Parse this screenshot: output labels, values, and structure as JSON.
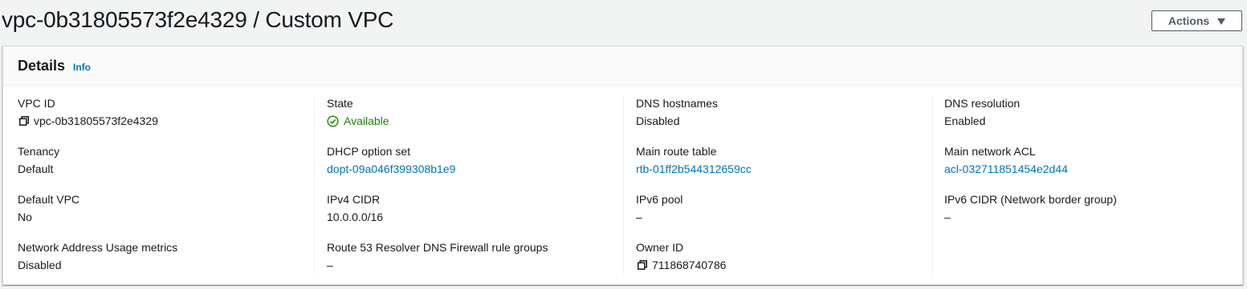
{
  "header": {
    "title": "vpc-0b31805573f2e4329 / Custom VPC",
    "actions_label": "Actions"
  },
  "details": {
    "title": "Details",
    "info_label": "Info",
    "columns": [
      {
        "fields": [
          {
            "label": "VPC ID",
            "value": "vpc-0b31805573f2e4329",
            "icon": "copy-icon"
          },
          {
            "label": "Tenancy",
            "value": "Default"
          },
          {
            "label": "Default VPC",
            "value": "No"
          },
          {
            "label": "Network Address Usage metrics",
            "value": "Disabled"
          }
        ]
      },
      {
        "fields": [
          {
            "label": "State",
            "value": "Available",
            "icon": "check-circle-icon",
            "status_color": "#1d8102"
          },
          {
            "label": "DHCP option set",
            "value": "dopt-09a046f399308b1e9",
            "link": true
          },
          {
            "label": "IPv4 CIDR",
            "value": "10.0.0.0/16"
          },
          {
            "label": "Route 53 Resolver DNS Firewall rule groups",
            "value": "–"
          }
        ]
      },
      {
        "fields": [
          {
            "label": "DNS hostnames",
            "value": "Disabled"
          },
          {
            "label": "Main route table",
            "value": "rtb-01ff2b544312659cc",
            "link": true
          },
          {
            "label": "IPv6 pool",
            "value": "–"
          },
          {
            "label": "Owner ID",
            "value": "711868740786",
            "icon": "copy-icon"
          }
        ]
      },
      {
        "fields": [
          {
            "label": "DNS resolution",
            "value": "Enabled"
          },
          {
            "label": "Main network ACL",
            "value": "acl-032711851454e2d44",
            "link": true
          },
          {
            "label": "IPv6 CIDR (Network border group)",
            "value": "–"
          }
        ]
      }
    ]
  },
  "colors": {
    "link": "#0073bb",
    "success": "#1d8102",
    "text": "#16191f",
    "background": "#f2f3f3"
  }
}
